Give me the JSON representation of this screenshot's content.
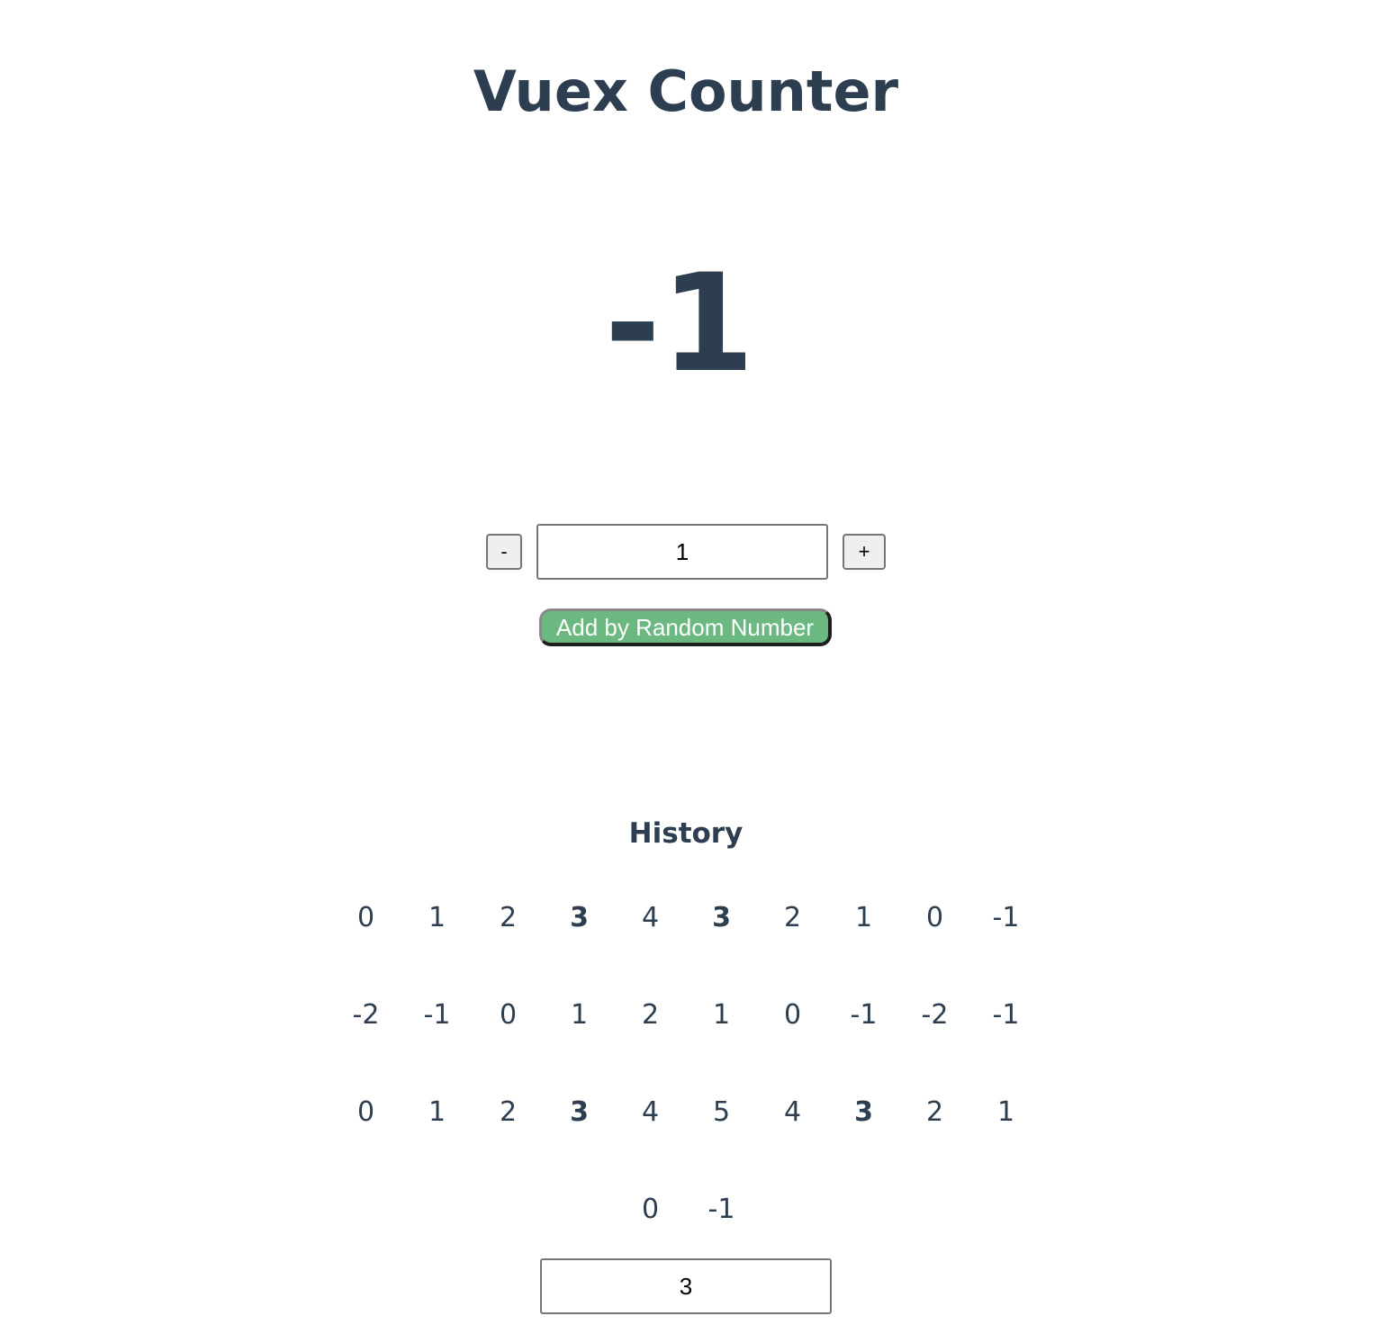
{
  "title": "Vuex Counter",
  "count": "-1",
  "controls": {
    "decrement_label": "-",
    "increment_label": "+",
    "step_value": "1",
    "random_button_label": "Add by Random Number"
  },
  "history": {
    "heading": "History",
    "items": [
      {
        "value": "0",
        "highlight": false
      },
      {
        "value": "1",
        "highlight": false
      },
      {
        "value": "2",
        "highlight": false
      },
      {
        "value": "3",
        "highlight": true
      },
      {
        "value": "4",
        "highlight": false
      },
      {
        "value": "3",
        "highlight": true
      },
      {
        "value": "2",
        "highlight": false
      },
      {
        "value": "1",
        "highlight": false
      },
      {
        "value": "0",
        "highlight": false
      },
      {
        "value": "-1",
        "highlight": false
      },
      {
        "value": "-2",
        "highlight": false
      },
      {
        "value": "-1",
        "highlight": false
      },
      {
        "value": "0",
        "highlight": false
      },
      {
        "value": "1",
        "highlight": false
      },
      {
        "value": "2",
        "highlight": false
      },
      {
        "value": "1",
        "highlight": false
      },
      {
        "value": "0",
        "highlight": false
      },
      {
        "value": "-1",
        "highlight": false
      },
      {
        "value": "-2",
        "highlight": false
      },
      {
        "value": "-1",
        "highlight": false
      },
      {
        "value": "0",
        "highlight": false
      },
      {
        "value": "1",
        "highlight": false
      },
      {
        "value": "2",
        "highlight": false
      },
      {
        "value": "3",
        "highlight": true
      },
      {
        "value": "4",
        "highlight": false
      },
      {
        "value": "5",
        "highlight": false
      },
      {
        "value": "4",
        "highlight": false
      },
      {
        "value": "3",
        "highlight": true
      },
      {
        "value": "2",
        "highlight": false
      },
      {
        "value": "1",
        "highlight": false
      },
      {
        "value": "0",
        "highlight": false
      },
      {
        "value": "-1",
        "highlight": false
      }
    ],
    "highlight_value": "3"
  },
  "colors": {
    "text": "#2c3e50",
    "accent": "#6bb881"
  }
}
